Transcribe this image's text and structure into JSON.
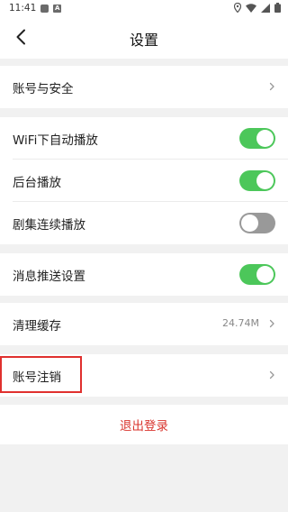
{
  "status_bar": {
    "time": "11:41",
    "left_icons": [
      "notification-square-icon",
      "a-app-icon"
    ],
    "right_icons": [
      "location-icon",
      "wifi-icon",
      "signal-icon",
      "battery-icon"
    ]
  },
  "header": {
    "back_icon": "chevron-left-icon",
    "title": "设置"
  },
  "sections": {
    "account": {
      "account_security_label": "账号与安全"
    },
    "playback": {
      "wifi_autoplay_label": "WiFi下自动播放",
      "wifi_autoplay_on": true,
      "background_play_label": "后台播放",
      "background_play_on": true,
      "continuous_play_label": "剧集连续播放",
      "continuous_play_on": false
    },
    "notifications": {
      "push_settings_label": "消息推送设置",
      "push_settings_on": true
    },
    "cache": {
      "clear_cache_label": "清理缓存",
      "cache_size": "24.74M"
    },
    "deactivate": {
      "deactivate_label": "账号注销",
      "highlighted": true
    }
  },
  "logout": {
    "label": "退出登录"
  },
  "colors": {
    "toggle_on": "#4cc75a",
    "toggle_off": "#999999",
    "logout_text": "#d9352e",
    "highlight_border": "#e0302e",
    "background": "#f1f1f1"
  }
}
